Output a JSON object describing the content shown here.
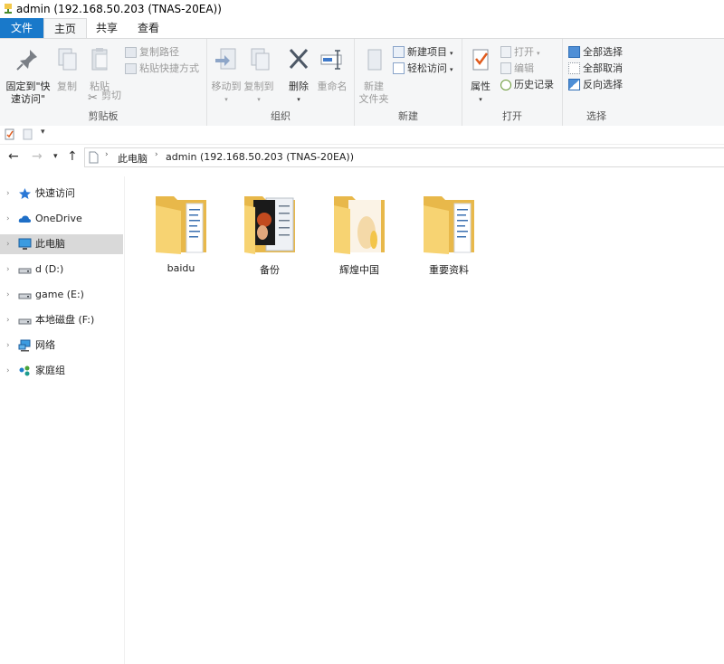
{
  "window": {
    "title": "admin (192.168.50.203 (TNAS-20EA))"
  },
  "tabs": [
    {
      "label": "文件"
    },
    {
      "label": "主页"
    },
    {
      "label": "共享"
    },
    {
      "label": "查看"
    }
  ],
  "ribbon": {
    "clipboard": {
      "label": "剪贴板",
      "pin": "固定到\"快",
      "pin2": "速访问\"",
      "copy": "复制",
      "paste": "粘贴",
      "copy_path": "复制路径",
      "paste_shortcut": "粘贴快捷方式",
      "cut": "剪切"
    },
    "organize": {
      "label": "组织",
      "move_to": "移动到",
      "copy_to": "复制到",
      "delete": "删除",
      "rename": "重命名"
    },
    "new": {
      "label": "新建",
      "new_folder": "新建",
      "new_folder2": "文件夹",
      "new_item": "新建项目",
      "easy_access": "轻松访问"
    },
    "open": {
      "label": "打开",
      "properties": "属性",
      "open": "打开",
      "edit": "编辑",
      "history": "历史记录"
    },
    "select": {
      "label": "选择",
      "select_all": "全部选择",
      "select_none": "全部取消",
      "invert": "反向选择"
    }
  },
  "address": {
    "crumb1": "此电脑",
    "crumb2": "admin (192.168.50.203 (TNAS-20EA))"
  },
  "nav": [
    {
      "label": "快速访问"
    },
    {
      "label": "OneDrive"
    },
    {
      "label": "此电脑"
    },
    {
      "label": "d (D:)"
    },
    {
      "label": "game (E:)"
    },
    {
      "label": "本地磁盘 (F:)"
    },
    {
      "label": "网络"
    },
    {
      "label": "家庭组"
    }
  ],
  "folders": [
    {
      "name": "baidu"
    },
    {
      "name": "备份"
    },
    {
      "name": "辉煌中国"
    },
    {
      "name": "重要资料"
    }
  ],
  "colors": {
    "file_tab": "#1979ca",
    "folder_yellow": "#f7d372",
    "nav_selected": "#d9d9d9"
  }
}
